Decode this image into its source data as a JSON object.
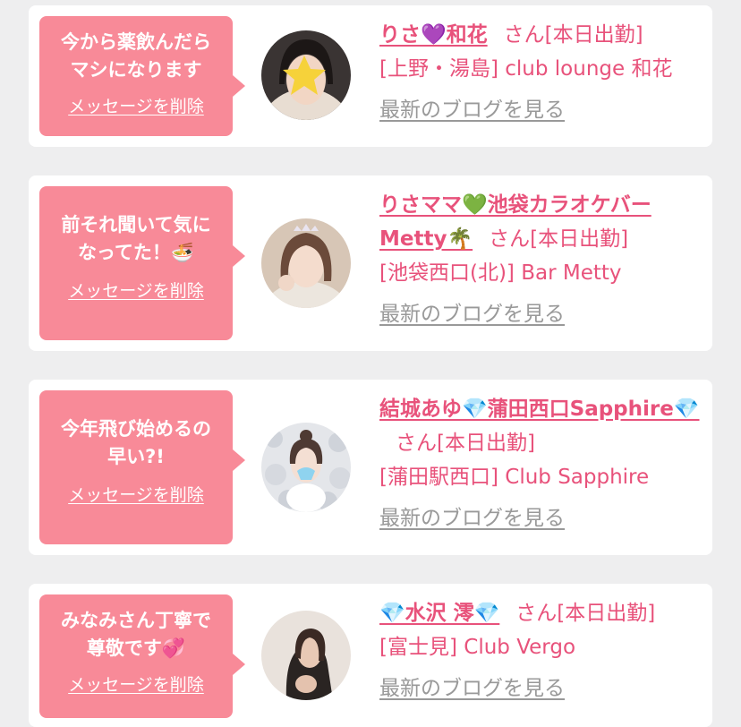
{
  "common": {
    "delete_label": "メッセージを削除",
    "blog_label": "最新のブログを見る",
    "accent_color": "#f88a98",
    "link_color": "#e8527b"
  },
  "messages": [
    {
      "message": "今から薬飲んだら\nマシになります",
      "emoji": "",
      "name_text": "りさ💜和花",
      "san_suffix": "さん[本日出勤]",
      "shop": "[上野・湯島] club lounge 和花"
    },
    {
      "message": "前それ聞いて気に\nなってた！",
      "emoji": "🍜",
      "name_text": "りさママ💚池袋カラオケバーMetty🌴",
      "san_suffix": "さん[本日出勤]",
      "shop": "[池袋西口(北)] Bar Metty"
    },
    {
      "message": "今年飛び始めるの\n早い?!",
      "emoji": "",
      "name_text": "結城あゆ💎蒲田西口Sapphire💎",
      "san_suffix": "さん[本日出勤]",
      "shop": "[蒲田駅西口] Club Sapphire"
    },
    {
      "message": "みなみさん丁寧で\n尊敬です",
      "emoji": "💞",
      "name_text": "💎水沢 澪💎",
      "san_suffix": "さん[本日出勤]",
      "shop": "[富士見] Club Vergo"
    }
  ]
}
